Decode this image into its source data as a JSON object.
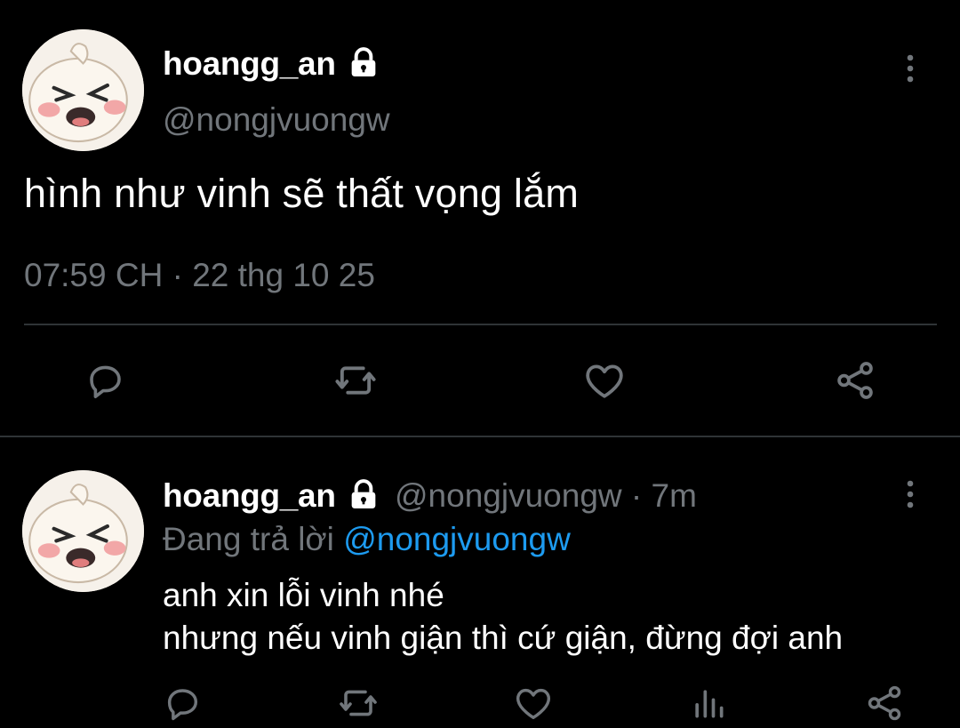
{
  "main_tweet": {
    "display_name": "hoangg_an",
    "handle": "@nongjvuongw",
    "text": "hình như vinh sẽ thất vọng lắm",
    "timestamp": "07:59 CH",
    "separator": "·",
    "date": "22 thg 10 25",
    "actions": [
      "reply-icon",
      "retweet-icon",
      "like-icon",
      "share-icon"
    ]
  },
  "reply_tweet": {
    "display_name": "hoangg_an",
    "handle": "@nongjvuongw",
    "separator": "·",
    "time_ago": "7m",
    "replying_prefix": "Đang trả lời",
    "replying_to": "@nongjvuongw",
    "line1": "anh xin lỗi vinh nhé",
    "line2": "nhưng nếu vinh giận thì cứ giận, đừng đợi anh",
    "actions": [
      "reply-icon",
      "retweet-icon",
      "like-icon",
      "views-icon",
      "share-icon"
    ]
  },
  "colors": {
    "background": "#000000",
    "primary_text": "#ffffff",
    "secondary_text": "#71767b",
    "link": "#1d9bf0",
    "divider": "#2f3336"
  }
}
